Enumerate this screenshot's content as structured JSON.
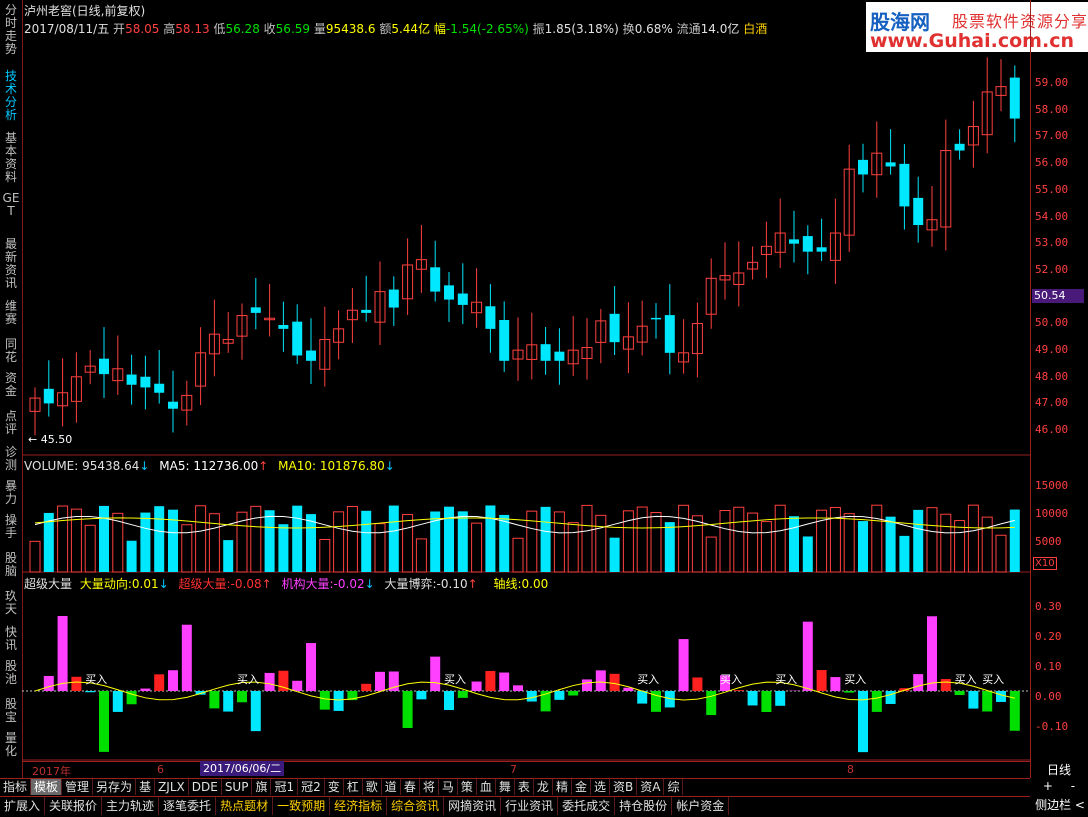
{
  "sidebar": {
    "items": [
      {
        "label": "分时走势",
        "active": false
      },
      {
        "label": "技术分析",
        "active": true
      },
      {
        "label": "基本资料",
        "active": false
      },
      {
        "label": "GET",
        "active": false
      },
      {
        "label": "最新资讯",
        "active": false
      },
      {
        "label": "维赛",
        "active": false
      },
      {
        "label": "同花",
        "active": false
      },
      {
        "label": "资金",
        "active": false
      },
      {
        "label": "点评",
        "active": false
      },
      {
        "label": "诊测",
        "active": false
      },
      {
        "label": "暴力",
        "active": false
      },
      {
        "label": "操手",
        "active": false
      },
      {
        "label": "股脑",
        "active": false
      },
      {
        "label": "玖天",
        "active": false
      },
      {
        "label": "快讯",
        "active": false
      },
      {
        "label": "股池",
        "active": false
      },
      {
        "label": "股宝",
        "active": false
      },
      {
        "label": "量化",
        "active": false
      }
    ]
  },
  "header": {
    "title": "泸州老窖(日线,前复权)",
    "date": "2017/08/11/五",
    "open_label": "开",
    "open": "58.05",
    "high_label": "高",
    "high": "58.13",
    "low_label": "低",
    "low": "56.28",
    "close_label": "收",
    "close": "56.59",
    "vol_label": "量",
    "vol": "95438.6",
    "amt_label": "额",
    "amt": "5.44亿",
    "chg_label": "幅",
    "chg": "-1.54(-2.65%)",
    "amp_label": "振",
    "amp": "1.85(3.18%)",
    "turn_label": "换",
    "turn": "0.68%",
    "float_label": "流通",
    "float": "14.0亿",
    "sector": "白酒"
  },
  "watermark": {
    "logo": "股海网",
    "slogan": "股票软件资源分享",
    "url": "www.Guhai.com.cn"
  },
  "price_axis": {
    "labels": [
      "59.00",
      "58.00",
      "57.00",
      "56.00",
      "55.00",
      "54.00",
      "53.00",
      "52.00",
      "51.00",
      "50.00",
      "49.00",
      "48.00",
      "47.00",
      "46.00"
    ],
    "current": "50.54",
    "low_marker": "45.50"
  },
  "volume": {
    "label": "VOLUME:",
    "value": "95438.64",
    "ma5_label": "MA5:",
    "ma5": "112736.00",
    "ma10_label": "MA10:",
    "ma10": "101876.80",
    "axis": [
      "15000",
      "10000",
      "5000"
    ],
    "unit": "X10"
  },
  "indicator": {
    "name": "超级大量",
    "dir_label": "大量动向:",
    "dir": "0.01",
    "super_label": "超级大量:",
    "super": "-0.08",
    "inst_label": "机构大量:",
    "inst": "-0.02",
    "game_label": "大量博弈:",
    "game": "-0.10",
    "axis_label": "轴线:",
    "axis_val": "0.00",
    "axis": [
      "0.30",
      "0.20",
      "0.10",
      "0.00",
      "-0.10"
    ],
    "signal": "买入"
  },
  "date_axis": {
    "labels": [
      "2017年",
      "6",
      "7",
      "8"
    ],
    "cursor": "2017/06/06/二",
    "period": "日线"
  },
  "tabs1": [
    "指标",
    "模板",
    "管理",
    "另存为",
    "基",
    "ZJLX",
    "DDE",
    "SUP",
    "旗",
    "冠1",
    "冠2",
    "变",
    "杠",
    "歌",
    "道",
    "春",
    "将",
    "马",
    "策",
    "血",
    "舞",
    "表",
    "龙",
    "精",
    "金",
    "选",
    "资B",
    "资A",
    "综"
  ],
  "tabs1_active": "模板",
  "tabs2": [
    "扩展入",
    "关联报价",
    "主力轨迹",
    "逐笔委托",
    "热点题材",
    "一致预期",
    "经济指标",
    "综合资讯",
    "网摘资讯",
    "行业资讯",
    "委托成交",
    "持仓股份",
    "帐户资金"
  ],
  "scroll": {
    "plus": "+",
    "minus": "-"
  },
  "sidebar_toggle": "侧边栏 <",
  "colors": {
    "up": "#ff4040",
    "down": "#00e8ff",
    "ma5": "#ffffff",
    "ma10": "#ffff00",
    "grid": "#9a1f1f"
  }
}
